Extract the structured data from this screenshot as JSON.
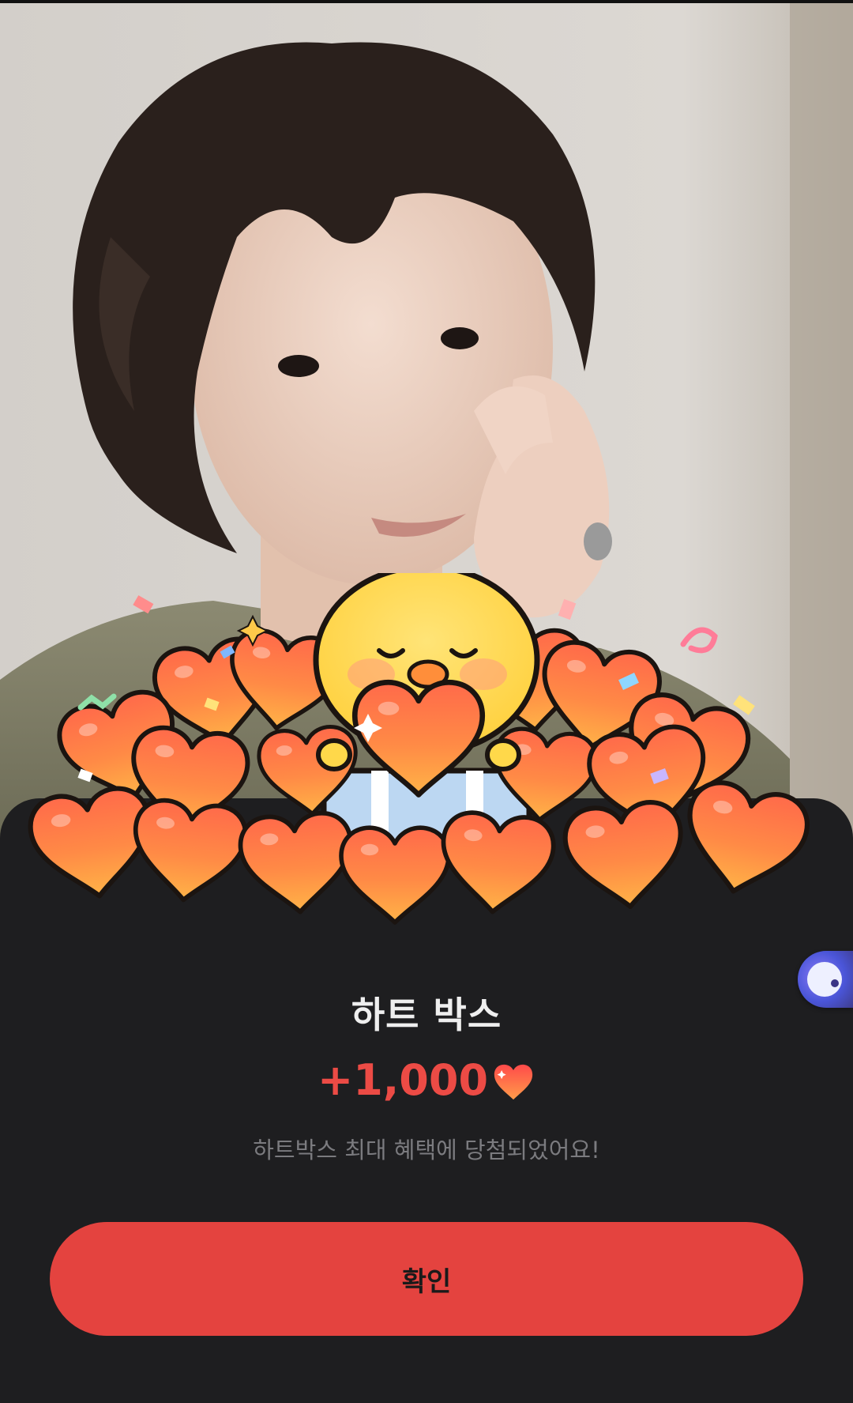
{
  "dialog": {
    "title": "하트 박스",
    "amount": "+1,000",
    "description": "하트박스 최대 혜택에 당첨되었어요!",
    "confirm_label": "확인"
  },
  "colors": {
    "sheet_background": "#1e1e20",
    "accent_red": "#e4433f",
    "amount_red": "#ec4b45",
    "title_text": "#efefef",
    "description_text": "#7b7b7f",
    "heart_orange": "#ff7a3c",
    "chick_yellow": "#ffd84a"
  },
  "icons": {
    "amount_icon": "heart-icon",
    "illustration": "chick-with-hearts-illustration",
    "floating": "assistant-bubble-icon"
  }
}
